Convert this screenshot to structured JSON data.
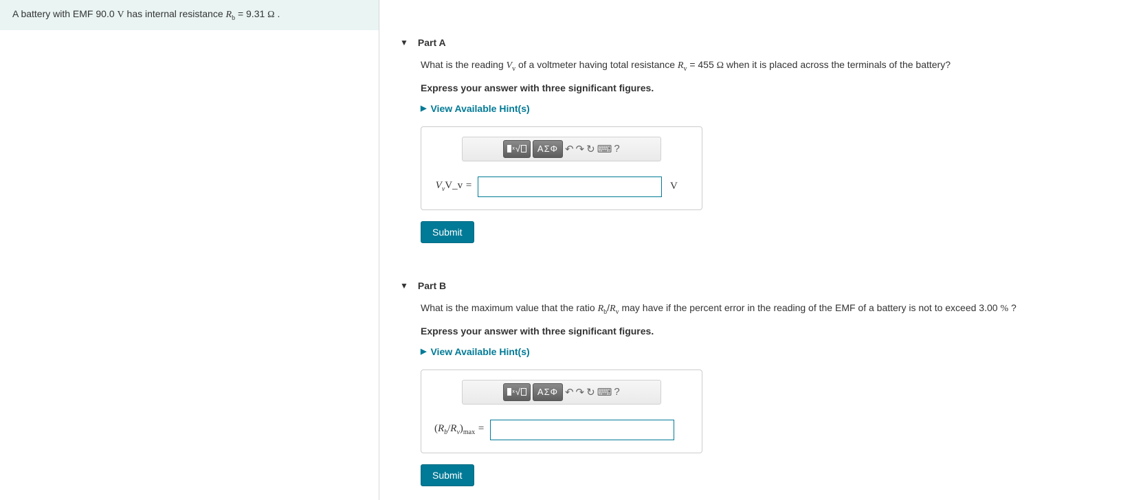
{
  "problem": {
    "prefix": "A battery with EMF 90.0 ",
    "emf_unit": "V",
    "mid": " has internal resistance ",
    "rb_var": "R",
    "rb_sub": "b",
    "rb_eq": " = 9.31 ",
    "rb_unit": "Ω",
    "suffix": " ."
  },
  "partA": {
    "title": "Part A",
    "q_prefix": "What is the reading ",
    "vv_var": "V",
    "vv_sub": "v",
    "q_mid1": " of a voltmeter having total resistance ",
    "rv_var": "R",
    "rv_sub": "v",
    "rv_eq": " = 455 ",
    "rv_unit": "Ω",
    "q_suffix": " when it is placed across the terminals of the battery?",
    "instruction": "Express your answer with three significant figures.",
    "hints_label": "View Available Hint(s)",
    "var_label_html": "V_v",
    "unit_label": "V",
    "submit": "Submit"
  },
  "partB": {
    "title": "Part B",
    "q_prefix": "What is the maximum value that the ratio ",
    "rb_var": "R",
    "rb_sub": "b",
    "slash": "/",
    "rv_var": "R",
    "rv_sub": "v",
    "q_mid": " may have if the percent error in the reading of the EMF of a battery is not to exceed 3.00 ",
    "percent": "%",
    "q_suffix": " ?",
    "instruction": "Express your answer with three significant figures.",
    "hints_label": "View Available Hint(s)",
    "var_label_prefix": "(R",
    "var_label_sub1": "b",
    "var_label_slash": "/R",
    "var_label_sub2": "v",
    "var_label_close": ")",
    "var_label_max": "max",
    "submit": "Submit"
  },
  "toolbar": {
    "greek_label": "ΑΣΦ",
    "help": "?"
  }
}
